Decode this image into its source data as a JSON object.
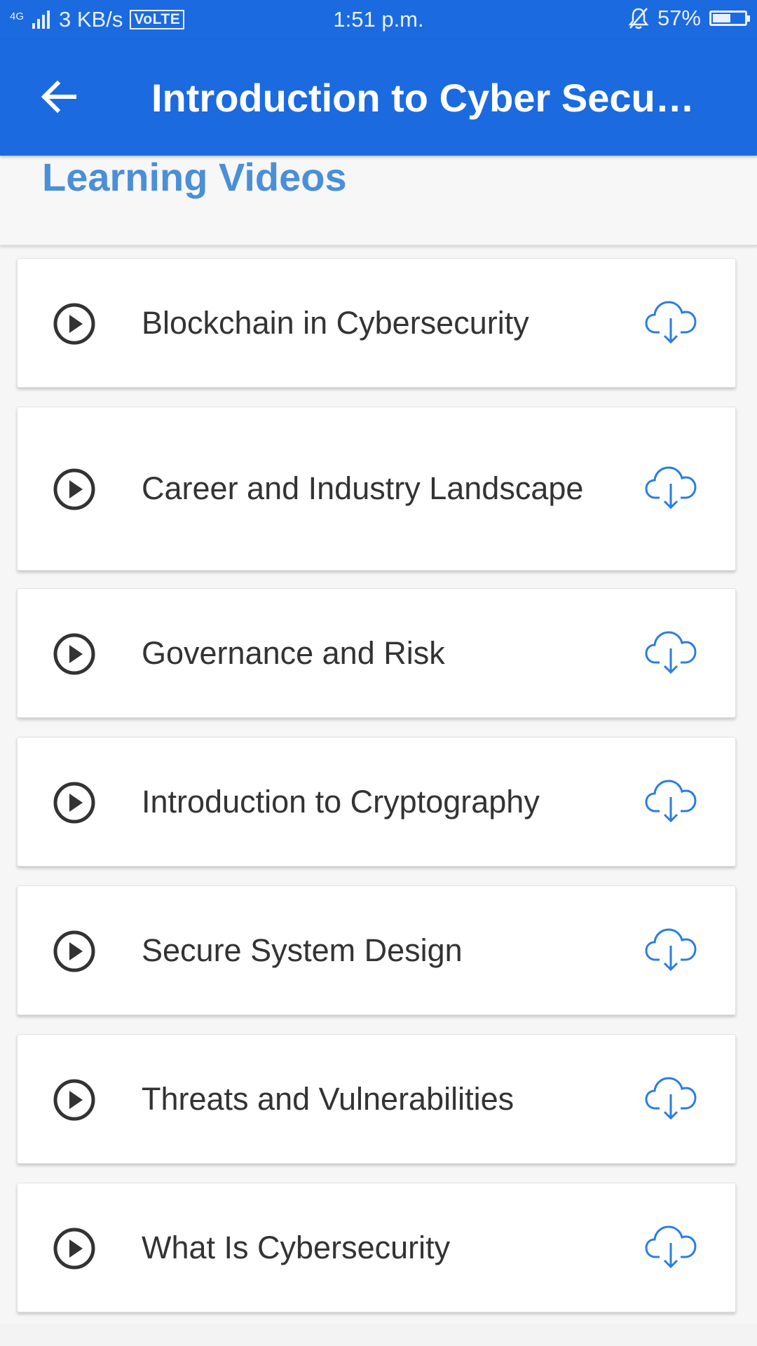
{
  "status_bar": {
    "network": "4G",
    "speed": "3 KB/s",
    "volte": "VoLTE",
    "time": "1:51 p.m.",
    "battery": "57%",
    "battery_level": 0.57
  },
  "app_bar": {
    "title": "Introduction to Cyber Securi..."
  },
  "section": {
    "title": "Learning Videos"
  },
  "videos": [
    {
      "label": "Blockchain in Cybersecurity"
    },
    {
      "label": "Career and Industry Landscape"
    },
    {
      "label": "Governance and Risk"
    },
    {
      "label": "Introduction to Cryptography"
    },
    {
      "label": "Secure System Design"
    },
    {
      "label": "Threats and Vulnerabilities"
    },
    {
      "label": "What Is Cybersecurity"
    }
  ],
  "colors": {
    "primary": "#1b6ae0",
    "section_title": "#4a8fd8",
    "download_icon": "#2a7de0",
    "play_icon": "#333333"
  },
  "icons": {
    "back": "arrow-back-icon",
    "play": "play-circle-icon",
    "download": "cloud-download-icon"
  }
}
